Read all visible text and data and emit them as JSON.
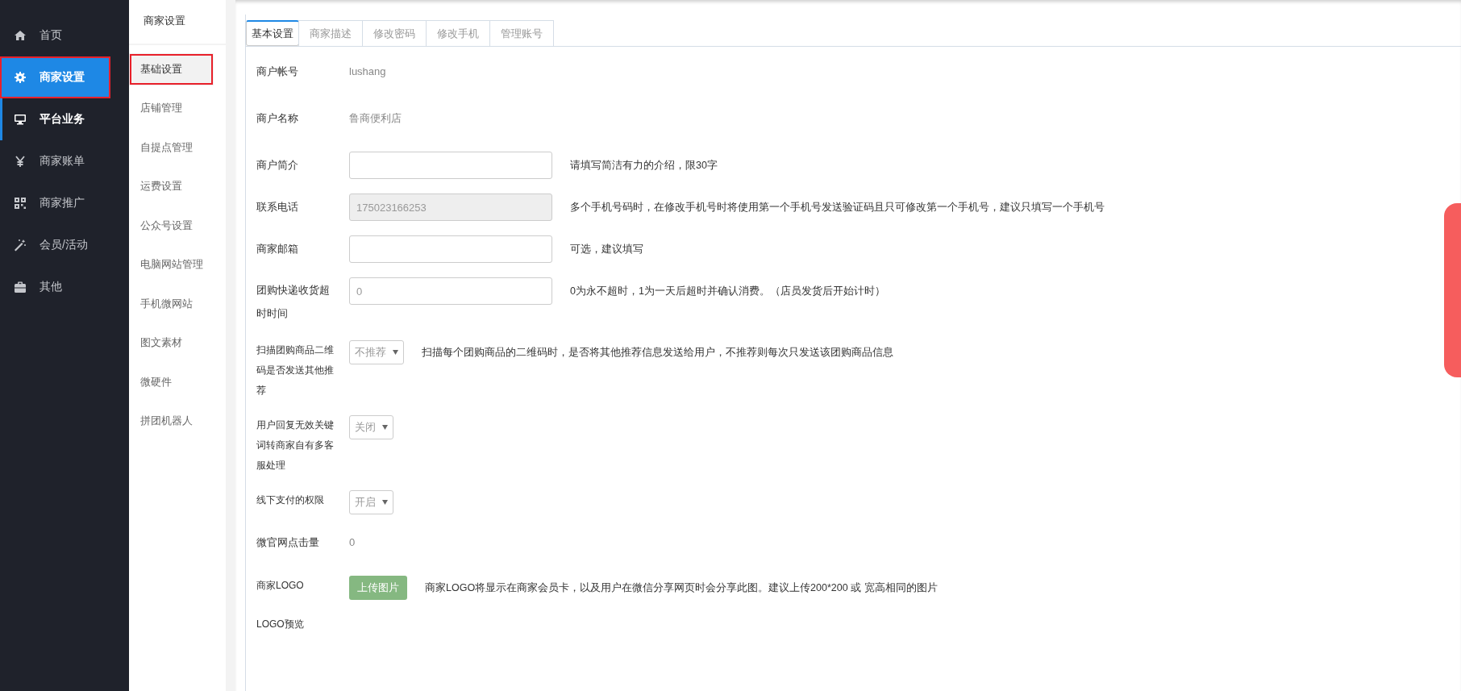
{
  "sidebar": {
    "items": [
      {
        "label": "首页",
        "selected": false,
        "hovered": false,
        "annotated": false
      },
      {
        "label": "商家设置",
        "selected": true,
        "hovered": false,
        "annotated": true
      },
      {
        "label": "平台业务",
        "selected": false,
        "hovered": true,
        "annotated": false
      },
      {
        "label": "商家账单",
        "selected": false,
        "hovered": false,
        "annotated": false
      },
      {
        "label": "商家推广",
        "selected": false,
        "hovered": false,
        "annotated": false
      },
      {
        "label": "会员/活动",
        "selected": false,
        "hovered": false,
        "annotated": false
      },
      {
        "label": "其他",
        "selected": false,
        "hovered": false,
        "annotated": false
      }
    ]
  },
  "subnav": {
    "title": "商家设置",
    "items": [
      {
        "label": "基础设置",
        "selected": true,
        "annotated": true
      },
      {
        "label": "店铺管理",
        "selected": false,
        "annotated": false
      },
      {
        "label": "自提点管理",
        "selected": false,
        "annotated": false
      },
      {
        "label": "运费设置",
        "selected": false,
        "annotated": false
      },
      {
        "label": "公众号设置",
        "selected": false,
        "annotated": false
      },
      {
        "label": "电脑网站管理",
        "selected": false,
        "annotated": false
      },
      {
        "label": "手机微网站",
        "selected": false,
        "annotated": false
      },
      {
        "label": "图文素材",
        "selected": false,
        "annotated": false
      },
      {
        "label": "微硬件",
        "selected": false,
        "annotated": false
      },
      {
        "label": "拼团机器人",
        "selected": false,
        "annotated": false
      }
    ]
  },
  "tabs": [
    {
      "label": "基本设置",
      "selected": true
    },
    {
      "label": "商家描述",
      "selected": false
    },
    {
      "label": "修改密码",
      "selected": false
    },
    {
      "label": "修改手机",
      "selected": false
    },
    {
      "label": "管理账号",
      "selected": false
    }
  ],
  "form": [
    {
      "kind": "text",
      "label": "商户帐号",
      "value": "lushang"
    },
    {
      "kind": "text",
      "label": "商户名称",
      "value": "鲁商便利店"
    },
    {
      "kind": "input",
      "label": "商户简介",
      "disabled": false,
      "help": "请填写简洁有力的介绍，限30字"
    },
    {
      "kind": "input",
      "label": "联系电话",
      "value": "175023166253",
      "disabled": true,
      "help": "多个手机号码时，在修改手机号时将使用第一个手机号发送验证码且只可修改第一个手机号，建议只填写一个手机号"
    },
    {
      "kind": "input",
      "label": "商家邮箱",
      "disabled": false,
      "help": "可选，建议填写"
    },
    {
      "kind": "input",
      "label": "团购快递收货超时时间",
      "value": "0",
      "disabled": false,
      "help": "0为永不超时，1为一天后超时并确认消费。（店员发货后开始计时）"
    },
    {
      "kind": "select",
      "label": "扫描团购商品二维码是否发送其他推荐",
      "value": "不推荐",
      "help": "扫描每个团购商品的二维码时，是否将其他推荐信息发送给用户，不推荐则每次只发送该团购商品信息"
    },
    {
      "kind": "select",
      "label": "用户回复无效关键词转商家自有多客服处理",
      "value": "关闭"
    },
    {
      "kind": "select",
      "label": "线下支付的权限",
      "value": "开启"
    },
    {
      "kind": "text",
      "label": "微官网点击量",
      "value": "0"
    },
    {
      "kind": "button",
      "label": "商家LOGO",
      "value": "上传图片",
      "help": "商家LOGO将显示在商家会员卡，以及用户在微信分享网页时会分享此图。建议上传200*200 或 宽高相同的图片"
    },
    {
      "kind": "none",
      "label": "LOGO预览"
    }
  ]
}
